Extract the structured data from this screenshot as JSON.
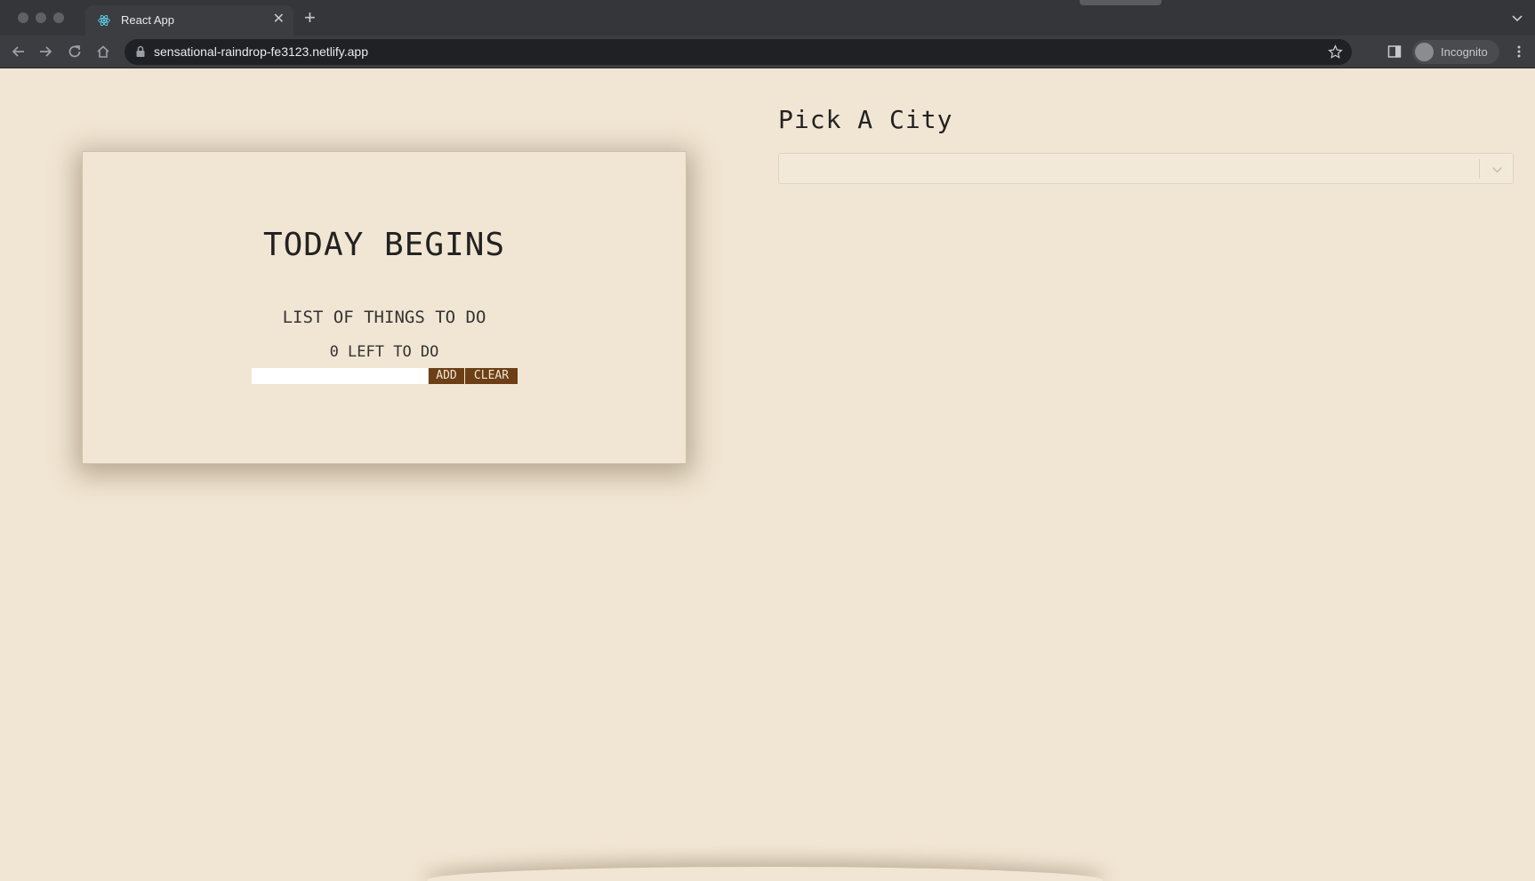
{
  "browser": {
    "tab_title": "React App",
    "url": "sensational-raindrop-fe3123.netlify.app",
    "profile_label": "Incognito"
  },
  "todo": {
    "title": "TODAY BEGINS",
    "subtitle": "LIST OF THINGS TO DO",
    "remaining": "0 LEFT TO DO",
    "input_value": "",
    "add_label": "ADD",
    "clear_label": "CLEAR"
  },
  "city": {
    "heading": "Pick A City",
    "selected": ""
  },
  "colors": {
    "page_background": "#f1e6d3",
    "button_background": "#6d3f16",
    "button_text": "#f1e6d3"
  },
  "icons": [
    "react-favicon-icon",
    "close-icon",
    "new-tab-icon",
    "back-icon",
    "forward-icon",
    "reload-icon",
    "home-icon",
    "lock-icon",
    "star-icon",
    "side-panel-icon",
    "incognito-icon",
    "more-menu-icon",
    "chevron-down-icon"
  ]
}
